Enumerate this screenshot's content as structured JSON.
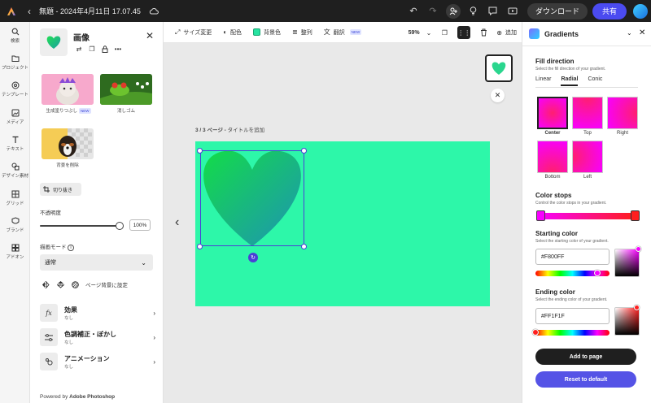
{
  "topbar": {
    "title": "無題 - 2024年4月11日 17.07.45",
    "download_label": "ダウンロード",
    "share_label": "共有"
  },
  "rail": {
    "items": [
      {
        "label": "検索",
        "icon": "search-icon"
      },
      {
        "label": "プロジェクト",
        "icon": "folder-icon"
      },
      {
        "label": "テンプレート",
        "icon": "template-icon"
      },
      {
        "label": "メディア",
        "icon": "media-icon"
      },
      {
        "label": "テキスト",
        "icon": "text-icon"
      },
      {
        "label": "デザイン素材",
        "icon": "shapes-icon"
      },
      {
        "label": "グリッド",
        "icon": "grid-icon"
      },
      {
        "label": "ブランド",
        "icon": "brand-icon"
      },
      {
        "label": "アドオン",
        "icon": "addon-icon"
      }
    ]
  },
  "panel": {
    "title": "画像",
    "tiles": [
      {
        "label": "生成塗りつぶし",
        "badge": "NEW"
      },
      {
        "label": "消しゴム"
      },
      {
        "label": "背景を削除"
      }
    ],
    "crop_label": "切り抜き",
    "opacity_label": "不透明度",
    "opacity_value": "100%",
    "opacity": 1.0,
    "blend_label": "描画モード",
    "blend_value": "通常",
    "set_bg_label": "ページ背景に設定",
    "menu": [
      {
        "title": "効果",
        "sub": "なし",
        "icon": "fx"
      },
      {
        "title": "色調補正・ぼかし",
        "sub": "なし",
        "icon": "sliders"
      },
      {
        "title": "アニメーション",
        "sub": "なし",
        "icon": "animation"
      }
    ],
    "powered_prefix": "Powered by ",
    "powered_brand": "Adobe Photoshop"
  },
  "toolbar": {
    "resize": "サイズ変更",
    "color": "配色",
    "bg_color": "背景色",
    "align": "整列",
    "translate": "翻訳",
    "translate_badge": "NEW",
    "zoom": "59%",
    "add": "追加"
  },
  "canvas": {
    "page_prefix": "3 / 3 ページ - ",
    "page_title": "タイトルを追加",
    "artboard_color": "#2df7a9"
  },
  "gradients": {
    "title": "Gradients",
    "fill_dir_title": "Fill direction",
    "fill_dir_sub": "Select the fill direction of your gradient.",
    "tabs": [
      "Linear",
      "Radial",
      "Conic"
    ],
    "active_tab": "Radial",
    "directions": [
      "Center",
      "Top",
      "Right",
      "Bottom",
      "Left"
    ],
    "selected_direction": "Center",
    "stops_title": "Color stops",
    "stops_sub": "Control the color stops in your gradient.",
    "start_title": "Starting color",
    "start_sub": "Select the starting color of your gradient.",
    "start_value": "#F800FF",
    "end_title": "Ending color",
    "end_sub": "Select the ending color of your gradient.",
    "end_value": "#FF1F1F",
    "add_label": "Add to page",
    "reset_label": "Reset to default"
  }
}
